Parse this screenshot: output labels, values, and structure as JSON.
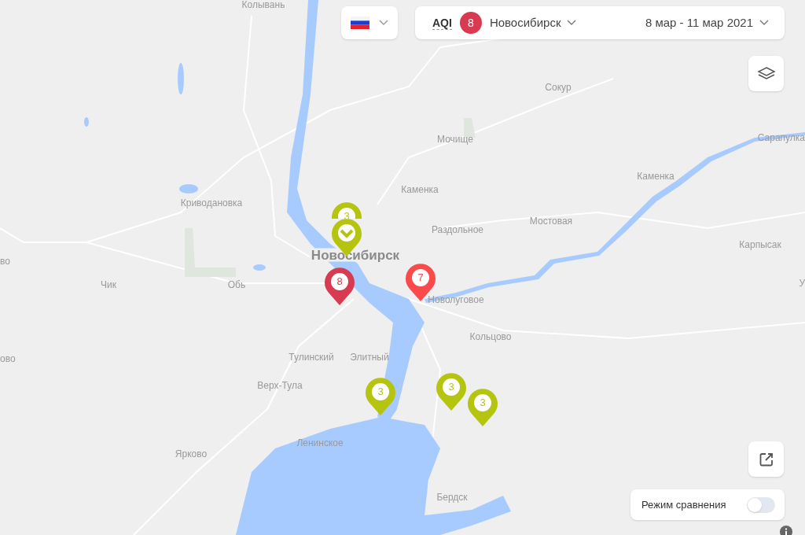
{
  "top_bar": {
    "index_label": "AQI",
    "index_value": "8",
    "city": "Новосибирск",
    "date_range": "8 мар - 11 мар 2021"
  },
  "map_labels": [
    {
      "text": "Колывань",
      "kind": "town"
    },
    {
      "text": "Сокур",
      "kind": "town"
    },
    {
      "text": "Мочище",
      "kind": "town"
    },
    {
      "text": "Сарапулка",
      "kind": "town"
    },
    {
      "text": "Каменка",
      "kind": "town"
    },
    {
      "text": "Каменка",
      "kind": "town"
    },
    {
      "text": "Криводановка",
      "kind": "town"
    },
    {
      "text": "Мостовая",
      "kind": "town"
    },
    {
      "text": "Раздольное",
      "kind": "town"
    },
    {
      "text": "Карпысак",
      "kind": "town"
    },
    {
      "text": "во",
      "kind": "town"
    },
    {
      "text": "Новосибирск",
      "kind": "city"
    },
    {
      "text": "Чик",
      "kind": "town"
    },
    {
      "text": "Обь",
      "kind": "town"
    },
    {
      "text": "У",
      "kind": "town"
    },
    {
      "text": "Новолуговое",
      "kind": "town"
    },
    {
      "text": "Кольцово",
      "kind": "town"
    },
    {
      "text": "ово",
      "kind": "town"
    },
    {
      "text": "Тулинский",
      "kind": "town"
    },
    {
      "text": "Элитный",
      "kind": "town"
    },
    {
      "text": "Верх-Тула",
      "kind": "town"
    },
    {
      "text": "Ленинское",
      "kind": "town"
    },
    {
      "text": "Ярково",
      "kind": "town"
    },
    {
      "text": "Бердск",
      "kind": "town"
    }
  ],
  "markers": [
    {
      "kind": "number",
      "value": "3",
      "color": "#b5c40f"
    },
    {
      "kind": "check",
      "color": "#b5c40f"
    },
    {
      "kind": "number",
      "value": "8",
      "color": "#d83a52"
    },
    {
      "kind": "number",
      "value": "7",
      "color": "#fa4a4a"
    },
    {
      "kind": "number",
      "value": "3",
      "color": "#b5c40f"
    },
    {
      "kind": "number",
      "value": "3",
      "color": "#b5c40f"
    },
    {
      "kind": "number",
      "value": "3",
      "color": "#b5c40f"
    }
  ],
  "compare_mode": {
    "label": "Режим сравнения",
    "on": false
  }
}
